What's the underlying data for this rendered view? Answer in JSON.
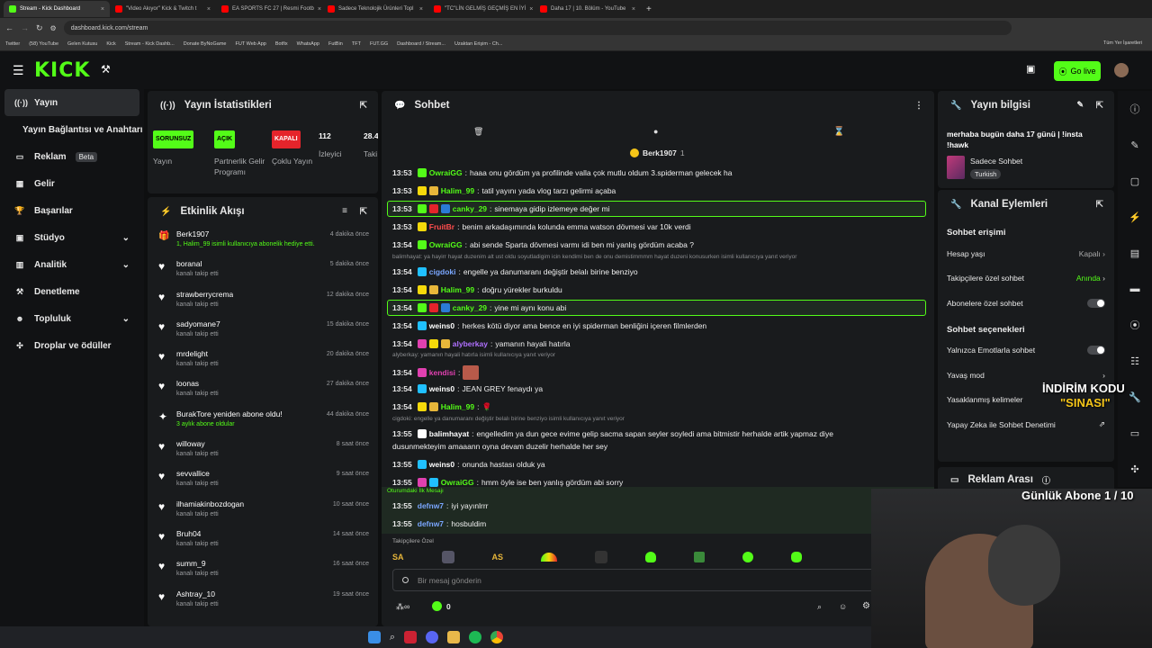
{
  "browser": {
    "tabs": [
      {
        "label": "Stream - Kick Dashboard",
        "color": "#53fc18",
        "active": true
      },
      {
        "label": "\"Video Akıyor\" Kick & Twitch t",
        "color": "#ff0000"
      },
      {
        "label": "EA SPORTS FC 27 | Resmi Footb",
        "color": "#ff0000"
      },
      {
        "label": "Sadece Teknolojik Ürünleri Topl",
        "color": "#ff0000"
      },
      {
        "label": "\"TC\"LİN GELMİŞ GEÇMİŞ EN İYİ",
        "color": "#ff0000"
      },
      {
        "label": "Daha 17 | 10. Bölüm - YouTube",
        "color": "#ff0000"
      }
    ],
    "url": "dashboard.kick.com/stream",
    "bookmarks": [
      "Twitter",
      "(58) YouTube",
      "Gelen Kutusu",
      "Kick",
      "Stream - Kick Dashb...",
      "Donate ByNoGame",
      "FUT Web App",
      "Botfix",
      "WhatsApp",
      "FutBin",
      "TFT",
      "FUT.GG",
      "Dashboard / Stream...",
      "Uzaktan Erişim - Ch..."
    ],
    "bookmarks_right": "Tüm Yer İşaretleri"
  },
  "topnav": {
    "logo": "KICK",
    "go_live": "Go live"
  },
  "sidebar": {
    "items": [
      {
        "label": "Yayın",
        "icon": "broadcast-icon",
        "active": true
      },
      {
        "label": "Yayın Bağlantısı ve Anahtarı",
        "icon": ""
      },
      {
        "label": "Reklam",
        "icon": "tv-icon",
        "badge": "Beta"
      },
      {
        "label": "Gelir",
        "icon": "wallet-icon"
      },
      {
        "label": "Başarılar",
        "icon": "trophy-icon"
      },
      {
        "label": "Stüdyo",
        "icon": "studio-icon",
        "chevron": true
      },
      {
        "label": "Analitik",
        "icon": "chart-icon",
        "chevron": true
      },
      {
        "label": "Denetleme",
        "icon": "hammer-icon"
      },
      {
        "label": "Topluluk",
        "icon": "people-icon",
        "chevron": true
      },
      {
        "label": "Droplar ve ödüller",
        "icon": "gift-icon"
      }
    ]
  },
  "stats": {
    "title": "Yayın İstatistikleri",
    "items": [
      {
        "badge": "SORUNSUZ",
        "badge_color": "#53fc18",
        "label": "Yayın"
      },
      {
        "badge": "AÇIK",
        "badge_color": "#53fc18",
        "label": "Partnerlik Gelir Programı"
      },
      {
        "badge": "KAPALI",
        "badge_color": "#e5242b",
        "label": "Çoklu Yayın"
      },
      {
        "badge": "112",
        "badge_color": "",
        "label": "İzleyici"
      },
      {
        "badge": "28.4",
        "badge_color": "",
        "label": "Taki"
      }
    ]
  },
  "activity": {
    "title": "Etkinlik Akışı",
    "items": [
      {
        "name": "Berk1907",
        "sub": "1, Halim_99 isimli kullanıcıya abonelik hediye etti.",
        "time": "4 dakika önce",
        "icon": "gift-icon",
        "sub_green": true
      },
      {
        "name": "boranal",
        "sub": "kanalı takip etti",
        "time": "5 dakika önce",
        "icon": "heart-icon"
      },
      {
        "name": "strawberrycrema",
        "sub": "kanalı takip etti",
        "time": "12 dakika önce",
        "icon": "heart-icon"
      },
      {
        "name": "sadyomane7",
        "sub": "kanalı takip etti",
        "time": "15 dakika önce",
        "icon": "heart-icon"
      },
      {
        "name": "mrdelight",
        "sub": "kanalı takip etti",
        "time": "20 dakika önce",
        "icon": "heart-icon"
      },
      {
        "name": "loonas",
        "sub": "kanalı takip etti",
        "time": "27 dakika önce",
        "icon": "heart-icon"
      },
      {
        "name": "BurakTore yeniden abone oldu!",
        "sub": "3 aylık abone oldular",
        "time": "44 dakika önce",
        "icon": "star-icon",
        "sub_green": true
      },
      {
        "name": "willoway",
        "sub": "kanalı takip etti",
        "time": "8 saat önce",
        "icon": "heart-icon"
      },
      {
        "name": "sevvallice",
        "sub": "kanalı takip etti",
        "time": "9 saat önce",
        "icon": "heart-icon"
      },
      {
        "name": "ilhamiakinbozdogan",
        "sub": "kanalı takip etti",
        "time": "10 saat önce",
        "icon": "heart-icon"
      },
      {
        "name": "Bruh04",
        "sub": "kanalı takip etti",
        "time": "14 saat önce",
        "icon": "heart-icon"
      },
      {
        "name": "summ_9",
        "sub": "kanalı takip etti",
        "time": "16 saat önce",
        "icon": "heart-icon"
      },
      {
        "name": "Ashtray_10",
        "sub": "kanalı takip etti",
        "time": "19 saat önce",
        "icon": "heart-icon"
      }
    ]
  },
  "chat": {
    "title": "Sohbet",
    "pinned": {
      "user": "Berk1907",
      "count": "1"
    },
    "messages": [
      {
        "time": "13:53",
        "user": "OwraiGG",
        "color": "#53fc18",
        "text": "haaa onu gördüm ya profilinde valla çok mutlu oldum 3.spiderman gelecek ha",
        "badges": [
          "#53fc18"
        ]
      },
      {
        "time": "13:53",
        "user": "Halim_99",
        "color": "#53fc18",
        "text": "tatil yayını yada vlog tarzı gelirmi açaba",
        "badges": [
          "#f5d90a",
          "#e7b63a"
        ]
      },
      {
        "time": "13:53",
        "user": "canky_29",
        "color": "#53fc18",
        "text": "sinemaya gidip izlemeye değer mi",
        "badges": [
          "#53fc18",
          "#e5242b",
          "#2b7bd6"
        ],
        "highlight": true
      },
      {
        "time": "13:53",
        "user": "FruitBr",
        "color": "#ff4d4d",
        "text": "benim arkadaşımında kolunda emma watson dövmesi var 10k verdi",
        "badges": [
          "#f5d90a"
        ]
      },
      {
        "time": "13:54",
        "user": "OwraiGG",
        "color": "#53fc18",
        "text": "abi sende Sparta dövmesi varmı idi ben mi yanlış gördüm acaba ?",
        "badges": [
          "#53fc18"
        ]
      },
      {
        "time": "13:54",
        "user": "cigdoki",
        "color": "#7aa7ff",
        "text": "engelle ya danumaranı değiştir belalı birine benziyo",
        "badges": [
          "#20c0ff"
        ],
        "reply": "balimhayat: ya hayirr hayat duzenim alt ust oldu soyutladigim icin kendimi ben de onu demistimmmm hayat duzeni konusurken isimli kullanıcıya yanıt veriyor"
      },
      {
        "time": "13:54",
        "user": "Halim_99",
        "color": "#53fc18",
        "text": "doğru yürekler burkuldu",
        "badges": [
          "#f5d90a",
          "#e7b63a"
        ]
      },
      {
        "time": "13:54",
        "user": "canky_29",
        "color": "#53fc18",
        "text": "yine mi aynı konu abi",
        "badges": [
          "#53fc18",
          "#e5242b",
          "#2b7bd6"
        ],
        "highlight": true
      },
      {
        "time": "13:54",
        "user": "weins0",
        "color": "#ffffff",
        "text": "herkes kötü diyor ama bence en iyi spiderman benliğini içeren filmlerden",
        "badges": [
          "#20c0ff"
        ]
      },
      {
        "time": "13:54",
        "user": "alyberkay",
        "color": "#b070ff",
        "text": "yamanın hayali hatırla",
        "badges": [
          "#e040b0",
          "#f5d90a",
          "#e7b63a"
        ]
      },
      {
        "time": "13:54",
        "user": "kendisi",
        "color": "#e040b0",
        "text": "",
        "badges": [
          "#e040b0"
        ],
        "reply": "alyberkay: yamanın hayali hatırla isimli kullanıcıya yanıt veriyor"
      },
      {
        "time": "13:54",
        "user": "weins0",
        "color": "#ffffff",
        "text": "JEAN GREY fenaydı ya",
        "badges": [
          "#20c0ff"
        ]
      },
      {
        "time": "13:54",
        "user": "Halim_99",
        "color": "#53fc18",
        "text": "🌹",
        "badges": [
          "#f5d90a",
          "#e7b63a"
        ]
      },
      {
        "time": "13:55",
        "user": "balimhayat",
        "color": "#ffffff",
        "text": "engelledim ya dun gece evime gelip sacma sapan seyler soyledi ama bitmistir herhalde artik yapmaz diye",
        "badges": [
          "#ffffff"
        ],
        "reply": "cigdoki: engelle ya danumaranı değiştir belalı birine benziyo isimli kullanıcıya yanıt veriyor",
        "cont": "dusunmekteyim amaaann oyna devam duzelir herhalde her sey"
      },
      {
        "time": "13:55",
        "user": "weins0",
        "color": "#ffffff",
        "text": "onunda hastası olduk ya",
        "badges": [
          "#20c0ff"
        ]
      },
      {
        "time": "13:55",
        "user": "OwraiGG",
        "color": "#53fc18",
        "text": "hmm öyle ise ben yanlış gördüm abi sorry",
        "badges": [
          "#e040b0",
          "#20c0ff"
        ]
      }
    ],
    "first_message_label": "Oturumdaki İlk Mesajı",
    "first_messages": [
      {
        "time": "13:55",
        "user": "defnw7",
        "color": "#7aa7ff",
        "text": "iyi yayınlrrr"
      },
      {
        "time": "13:55",
        "user": "defnw7",
        "color": "#7aa7ff",
        "text": "hosbuldim"
      }
    ],
    "followers_label": "Takipçilere Özel",
    "input_placeholder": "Bir mesaj gönderin",
    "points": "0"
  },
  "stream_info": {
    "title": "Yayın bilgisi",
    "stream_title": "merhaba bugün daha 17 günü | !insta !hawk",
    "category": "Sadece Sohbet",
    "language": "Turkish"
  },
  "channel_actions": {
    "title": "Kanal Eylemleri",
    "access_heading": "Sohbet erişimi",
    "account_age": {
      "label": "Hesap yaşı",
      "value": "Kapalı"
    },
    "followers_only": {
      "label": "Takipçilere özel sohbet",
      "value": "Anında"
    },
    "subs_only": {
      "label": "Abonelere özel sohbet"
    },
    "options_heading": "Sohbet seçenekleri",
    "emotes_only": {
      "label": "Yalnızca Emotlarla sohbet"
    },
    "slow_mode": {
      "label": "Yavaş mod"
    },
    "banned_words": {
      "label": "Yasaklanmış kelimeler"
    },
    "ai_moderation": {
      "label": "Yapay Zeka ile Sohbet Denetimi"
    },
    "ad_break": "Reklam Arası"
  },
  "overlay": {
    "promo1": "İNDİRİM KODU",
    "promo2": "\"SINASI\"",
    "daily_subs": "Günlük Abone 1 / 10"
  },
  "colors": {
    "accent": "#53fc18",
    "panel": "#191b1d",
    "bg": "#0e0f10"
  }
}
